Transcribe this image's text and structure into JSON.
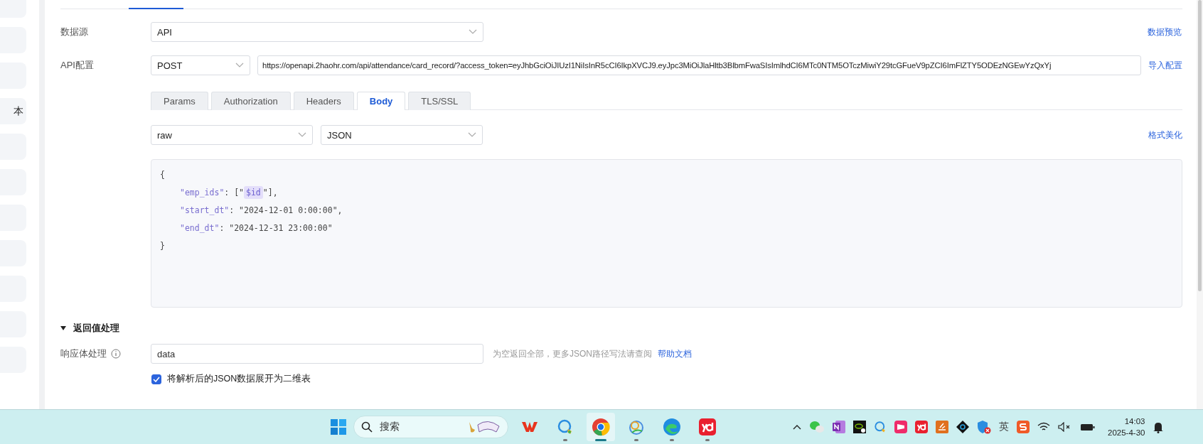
{
  "sidebar": {
    "items": [
      {
        "label": "本"
      }
    ]
  },
  "form": {
    "data_source": {
      "label": "数据源",
      "value": "API",
      "link": "数据预览"
    },
    "api_config": {
      "label": "API配置",
      "method": "POST",
      "url": "https://openapi.2haohr.com/api/attendance/card_record/?access_token=eyJhbGciOiJIUzI1NiIsInR5cCI6IkpXVCJ9.eyJpc3MiOiJlaHltb3BlbmFwaSIsImlhdCI6MTc0NTM5OTczMiwiY29tcGFueV9pZCI6ImFlZTY5ODEzNGEwYzQxYj",
      "link": "导入配置"
    },
    "tabs": [
      {
        "label": "Params",
        "selected": false
      },
      {
        "label": "Authorization",
        "selected": false
      },
      {
        "label": "Headers",
        "selected": false
      },
      {
        "label": "Body",
        "selected": true
      },
      {
        "label": "TLS/SSL",
        "selected": false
      }
    ],
    "body_type": "raw",
    "body_format": "JSON",
    "format_link": "格式美化",
    "body_lines": [
      [
        {
          "kind": "punct",
          "text": "{"
        }
      ],
      [
        {
          "kind": "key",
          "text": "\"emp_ids\""
        },
        {
          "kind": "punct",
          "text": ": [\""
        },
        {
          "kind": "variable",
          "text": "$id"
        },
        {
          "kind": "punct",
          "text": "\"],"
        }
      ],
      [
        {
          "kind": "key",
          "text": "\"start_dt\""
        },
        {
          "kind": "punct",
          "text": ": \"2024-12-01 0:00:00\","
        }
      ],
      [
        {
          "kind": "key",
          "text": "\"end_dt\""
        },
        {
          "kind": "punct",
          "text": ": \"2024-12-31 23:00:00\""
        }
      ],
      [
        {
          "kind": "punct",
          "text": "}"
        }
      ]
    ],
    "response_section": {
      "title": "返回值处理",
      "expanded": true
    },
    "response_body": {
      "label": "响应体处理",
      "value": "data",
      "hint": "为空返回全部，更多JSON路径写法请查阅",
      "link": "帮助文档"
    },
    "flatten": {
      "label": "将解析后的JSON数据展开为二维表",
      "checked": true
    }
  },
  "taskbar": {
    "search": {
      "placeholder": "搜索"
    },
    "apps": [
      {
        "kind": "wps",
        "running": false,
        "selected": false
      },
      {
        "kind": "chat",
        "running": true,
        "selected": false
      },
      {
        "kind": "chrome",
        "running": true,
        "selected": true
      },
      {
        "kind": "swirl",
        "running": true,
        "selected": false
      },
      {
        "kind": "edge",
        "running": true,
        "selected": false
      },
      {
        "kind": "yd",
        "running": true,
        "selected": false
      }
    ],
    "tray": [
      {
        "kind": "wechat"
      },
      {
        "kind": "onenote"
      },
      {
        "kind": "nvidia"
      },
      {
        "kind": "chat"
      },
      {
        "kind": "pink"
      },
      {
        "kind": "yd"
      },
      {
        "kind": "orange"
      },
      {
        "kind": "diamond"
      },
      {
        "kind": "shield"
      },
      {
        "kind": "ime",
        "text": "英"
      },
      {
        "kind": "sogou"
      }
    ],
    "time": "14:03",
    "date": "2025-4-30"
  }
}
